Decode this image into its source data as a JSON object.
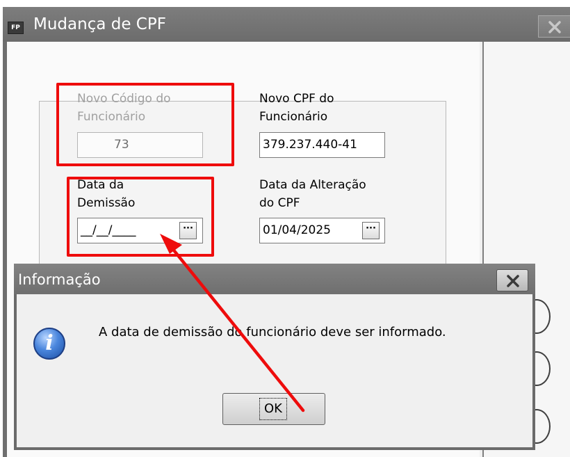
{
  "window": {
    "app_icon_text": "FP",
    "title": "Mudança de CPF"
  },
  "form": {
    "new_code_label_line1": "Novo Código do",
    "new_code_label_line2": "Funcionário",
    "new_code_value": "73",
    "new_cpf_label_line1": "Novo CPF do",
    "new_cpf_label_line2": "Funcionário",
    "new_cpf_value": "379.237.440-41",
    "dismissal_date_label_line1": "Data da",
    "dismissal_date_label_line2": "Demissão",
    "dismissal_date_value": "__/__/____",
    "change_date_label_line1": "Data da Alteração",
    "change_date_label_line2": "do CPF",
    "change_date_value": "01/04/2025",
    "picker_button_label": "···"
  },
  "dialog": {
    "title": "Informação",
    "icon_text": "i",
    "message": "A data de demissão do funcionário deve ser informado.",
    "ok_label": "OK"
  },
  "colors": {
    "highlight": "#ee0c0c",
    "titlebar": "#767676"
  },
  "icons": {
    "app": "fp-app-icon",
    "close": "close-icon",
    "info": "info-icon",
    "ellipsis": "ellipsis-icon"
  }
}
